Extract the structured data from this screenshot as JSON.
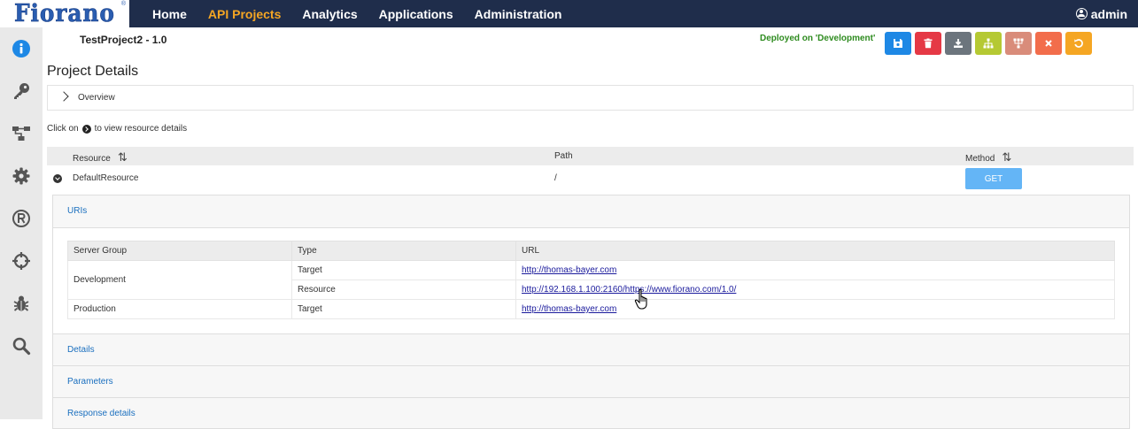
{
  "app": {
    "logo_text": "Fiorano",
    "logo_mark": "®"
  },
  "nav": {
    "items": [
      {
        "label": "Home"
      },
      {
        "label": "API Projects"
      },
      {
        "label": "Analytics"
      },
      {
        "label": "Applications"
      },
      {
        "label": "Administration"
      }
    ],
    "active_index": 1
  },
  "user": {
    "name": "admin"
  },
  "sidebar": {
    "icons": [
      "info-icon",
      "key-icon",
      "flow-icon",
      "gear-icon",
      "registered-icon",
      "crosshair-icon",
      "bug-icon",
      "search-icon"
    ]
  },
  "project": {
    "title": "TestProject2 - 1.0",
    "deployed_status": "Deployed on 'Development'"
  },
  "toolbar": {
    "buttons": [
      {
        "name": "save",
        "icon": "save-icon",
        "color": "#1e88e5"
      },
      {
        "name": "delete",
        "icon": "trash-icon",
        "color": "#e53945"
      },
      {
        "name": "download",
        "icon": "download-icon",
        "color": "#6c757d"
      },
      {
        "name": "deploy",
        "icon": "sitemap-icon",
        "color": "#b5c933"
      },
      {
        "name": "undeploy",
        "icon": "sitemap-down-icon",
        "color": "#d98c7a"
      },
      {
        "name": "close",
        "icon": "close-icon",
        "color": "#f26d4b"
      },
      {
        "name": "reset",
        "icon": "undo-icon",
        "color": "#f5a623"
      }
    ]
  },
  "details": {
    "heading": "Project Details",
    "overview_label": "Overview",
    "hint_before": "Click on",
    "hint_after": "to view resource details"
  },
  "resources": {
    "columns": {
      "resource": "Resource",
      "path": "Path",
      "method": "Method"
    },
    "rows": [
      {
        "resource": "DefaultResource",
        "path": "/",
        "method": "GET"
      }
    ]
  },
  "panel": {
    "uris_title": "URIs",
    "details_title": "Details",
    "parameters_title": "Parameters",
    "response_title": "Response details",
    "url_table": {
      "columns": {
        "server_group": "Server Group",
        "type": "Type",
        "url": "URL"
      },
      "rows": [
        {
          "group": "Development",
          "type": "Target",
          "url": "http://thomas-bayer.com"
        },
        {
          "group": "",
          "type": "Resource",
          "url": "http://192.168.1.100:2160/https://www.fiorano.com/1.0/"
        },
        {
          "group": "Production",
          "type": "Target",
          "url": "http://thomas-bayer.com"
        }
      ]
    }
  }
}
